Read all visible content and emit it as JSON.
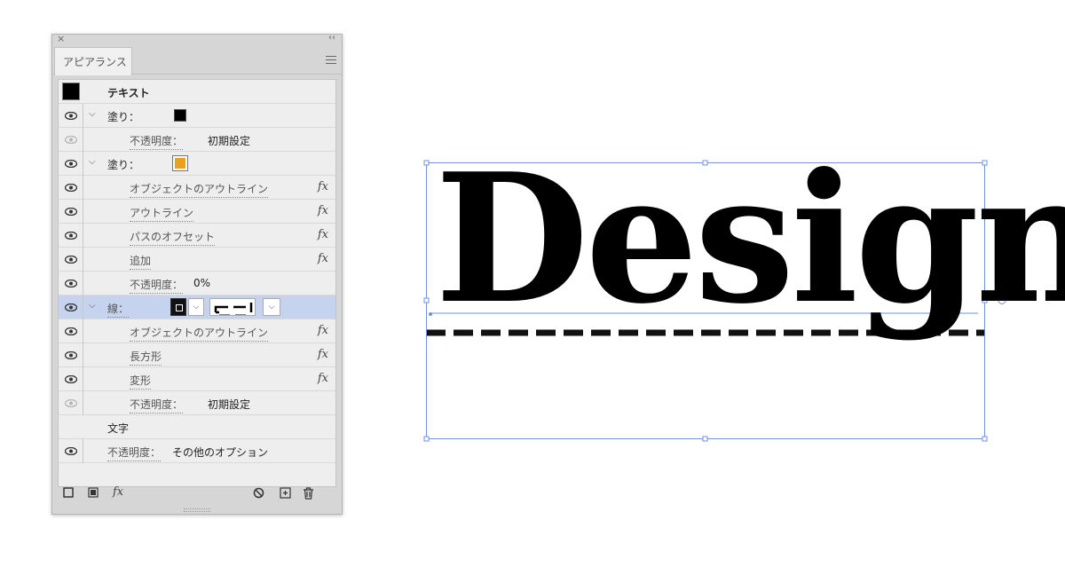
{
  "panel": {
    "tab_label": "アピアランス",
    "close_glyph": "×",
    "collapse_glyph": "‹‹"
  },
  "rows": {
    "text_heading": "テキスト",
    "fill1_label": "塗り：",
    "fill1_opacity_label": "不透明度：",
    "fill1_opacity_value": "初期設定",
    "fill2_label": "塗り：",
    "fill2_swatch_color": "#e7a21e",
    "fx_outline_object": "オブジェクトのアウトライン",
    "fx_outline": "アウトライン",
    "fx_offset_path": "パスのオフセット",
    "fx_add": "追加",
    "fill2_opacity_label": "不透明度：",
    "fill2_opacity_value": "0%",
    "stroke_label": "線：",
    "stroke_fx_outline_object": "オブジェクトのアウトライン",
    "stroke_fx_rect": "長方形",
    "stroke_fx_transform": "変形",
    "stroke_opacity_label": "不透明度：",
    "stroke_opacity_value": "初期設定",
    "char_label": "文字",
    "char_opacity_label": "不透明度：",
    "char_opacity_value": "その他のオプション",
    "fx_glyph": "fx"
  },
  "colors": {
    "selection_bbox": "#6f8fdc",
    "selected_row": "#c5d3ee",
    "fill2_swatch": "#e7a21e"
  },
  "footer_icons": [
    "new-stroke-icon",
    "new-fill-icon",
    "fx-menu-icon",
    "clear-icon",
    "duplicate-icon",
    "delete-icon"
  ],
  "canvas": {
    "text": "Design"
  }
}
